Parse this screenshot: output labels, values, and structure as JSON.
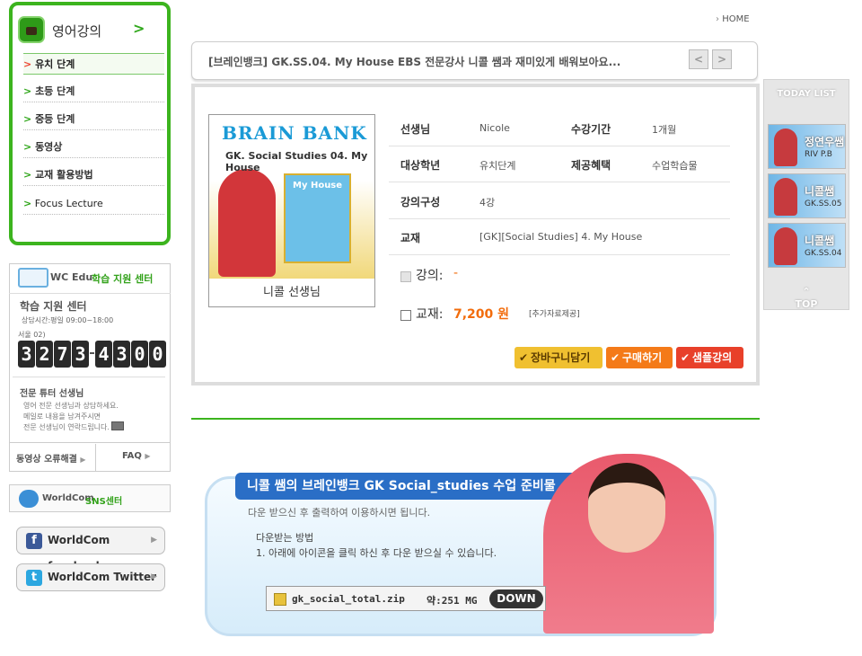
{
  "menu": {
    "title": "영어강의",
    "arrow": ">",
    "items": [
      {
        "label": "유치 단계"
      },
      {
        "label": "초등 단계"
      },
      {
        "label": "중등 단계"
      },
      {
        "label": "동영상"
      },
      {
        "label": "교재 활용방법"
      },
      {
        "label": "Focus Lecture"
      }
    ]
  },
  "support": {
    "logo": "WC Edu",
    "logo_sub": "학습 지원 센터",
    "title": "학습 지원 센터",
    "hours": "상담시간:평일 09:00~18:00",
    "area": "서울 02)",
    "phone": [
      "3",
      "2",
      "7",
      "3",
      "4",
      "3",
      "0",
      "0"
    ],
    "tutor_title": "전문 튜터 선생님",
    "tutor_desc_1": "영어 전문 선생님과 상담하세요.",
    "tutor_desc_2": "메일로 내용을 남겨주시면",
    "tutor_desc_3": "전문 선생님이 연락드립니다.",
    "link_error": "동영상 오류해결",
    "link_faq": "FAQ"
  },
  "sns": {
    "title": "WorldCom",
    "title_sub": "SNS센터",
    "facebook": "WorldCom facebook",
    "twitter": "WorldCom Twitter"
  },
  "header": {
    "home": "HOME",
    "title": "[브레인뱅크] GK.SS.04. My House EBS 전문강사 니콜 쌤과 재미있게 배워보아요..."
  },
  "product": {
    "cover_brand": "BRAIN BANK",
    "cover_title": "GK. Social Studies 04. My House",
    "cover_book": "My House",
    "caption": "니콜 선생님",
    "fields": {
      "teacher_label": "선생님",
      "teacher": "Nicole",
      "period_label": "수강기간",
      "period": "1개월",
      "grade_label": "대상학년",
      "grade": "유치단계",
      "benefit_label": "제공혜택",
      "benefit": "수업학습물",
      "composition_label": "강의구성",
      "composition": "4강",
      "textbook_label": "교재",
      "textbook": "[GK][Social Studies] 4. My House"
    },
    "lecture_label": "강의:",
    "lecture_price": "-",
    "book_label": "교재:",
    "book_price": "7,200 원",
    "book_note": "[추가자료제공]",
    "btn_cart": "장바구니담기",
    "btn_buy": "구매하기",
    "btn_sample": "샘플강의"
  },
  "today": {
    "title": "TODAY LIST",
    "items": [
      {
        "name": "정연우쌤",
        "sub": "RIV P.B"
      },
      {
        "name": "니콜쌤",
        "sub": "GK.SS.05"
      },
      {
        "name": "니콜쌤",
        "sub": "GK.SS.04"
      }
    ],
    "top": "TOP"
  },
  "banner": {
    "title": "니콜 쌤의 브레인뱅크 GK Social_studies 수업 준비물",
    "desc": "다운 받으신 후 출력하여 이용하시면 됩니다.",
    "how_title": "다운받는 방법",
    "how_step": "1. 아래에 아이콘을 클릭 하신 후 다운 받으실 수 있습니다.",
    "filename": "gk_social_total.zip",
    "size": "약:251 MG",
    "down": "DOWN"
  },
  "colors": {
    "green": "#3cb41e",
    "orange": "#f26c0c",
    "blue": "#2a6ec6"
  }
}
